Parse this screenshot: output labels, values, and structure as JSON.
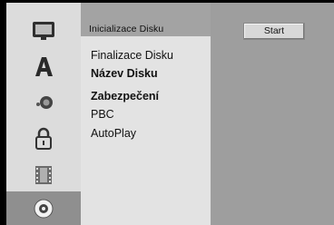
{
  "rail": {
    "icons": [
      "display-icon",
      "text-a-icon",
      "speaker-icon",
      "lock-icon",
      "film-icon",
      "disc-icon"
    ],
    "selected_index": 5,
    "colors": {
      "rail_bg": "#dcdcdc",
      "selected_bg": "#8f8f8f",
      "icon_dark": "#333333"
    }
  },
  "menu": {
    "header": "Inicializace Disku",
    "items": [
      {
        "label": "Finalizace Disku",
        "bold": false
      },
      {
        "label": "Název Disku",
        "bold": true
      },
      {
        "label": "Zabezpečení",
        "bold": true
      },
      {
        "label": "PBC",
        "bold": false
      },
      {
        "label": "AutoPlay",
        "bold": false
      }
    ]
  },
  "action": {
    "start_label": "Start"
  },
  "colors": {
    "header_bg": "#a3a3a3",
    "menu_bg": "#e3e3e3",
    "right_bg": "#9e9e9e",
    "button_bg": "#d8d8d8"
  }
}
